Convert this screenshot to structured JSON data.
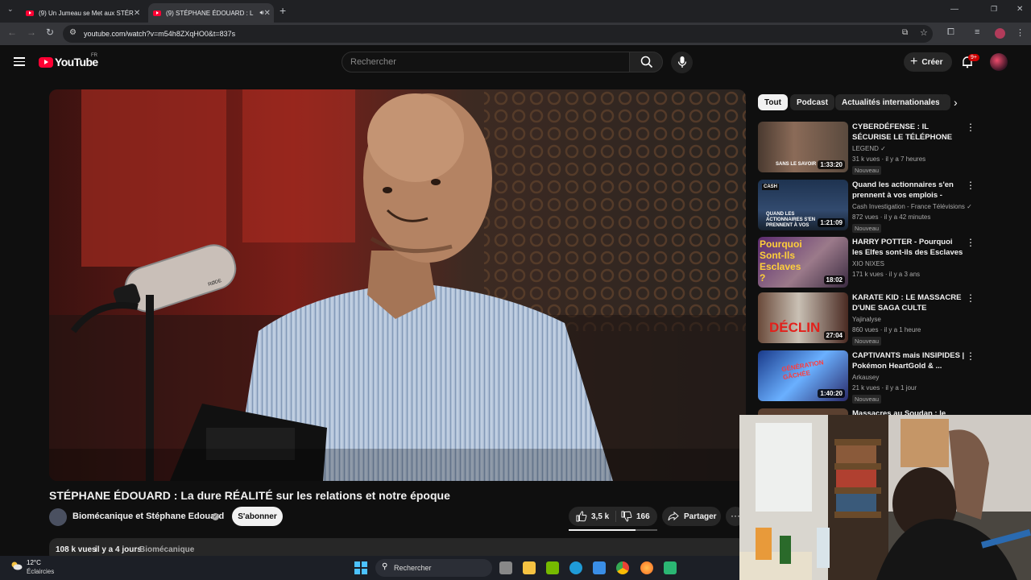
{
  "browser": {
    "tabs": [
      {
        "title": "(9) Un Jumeau se Met aux STÉR"
      },
      {
        "title": "(9) STÉPHANE ÉDOUARD : L"
      }
    ],
    "url": "youtube.com/watch?v=m54h8ZXqHO0&t=837s"
  },
  "header": {
    "logo": "YouTube",
    "region": "FR",
    "search_placeholder": "Rechercher",
    "create_label": "Créer",
    "notification_count": "9+"
  },
  "video": {
    "title": "STÉPHANE ÉDOUARD : La dure RÉALITÉ sur les relations et notre époque",
    "channel": "Biomécanique et Stéphane Edouard",
    "subscribe_label": "S'abonner",
    "likes": "3,5 k",
    "dislikes": "166",
    "share_label": "Partager",
    "more_label": "···",
    "views": "108 k vues",
    "date": "il y a 4 jours",
    "tag": "Biomécanique",
    "mic_brand": "RØDE"
  },
  "chips": [
    "Tout",
    "Podcast",
    "Actualités internationales"
  ],
  "recommendations": [
    {
      "title": "CYBERDÉFENSE : IL SÉCURISE LE TÉLÉPHONE DU PRÉSIDEN...",
      "channel": "LEGEND",
      "verified": true,
      "meta": "31 k vues · il y a 7 heures",
      "badge": "Nouveau",
      "duration": "1:33:20",
      "thumb_text": "SANS LE SAVOIR"
    },
    {
      "title": "Quand les actionnaires s'en prennent à vos emplois - Cash...",
      "channel": "Cash Investigation - France Télévisions",
      "verified": true,
      "meta": "872 vues · il y a 42 minutes",
      "badge": "Nouveau",
      "duration": "1:21:09",
      "thumb_text": "QUAND LES ACTIONNAIRES S'EN PRENNENT À VOS",
      "thumb_label": "CASH"
    },
    {
      "title": "HARRY POTTER - Pourquoi les Elfes sont-ils des Esclaves ?",
      "channel": "XIO NIXES",
      "verified": false,
      "meta": "171 k vues · il y a 3 ans",
      "badge": "",
      "duration": "18:02",
      "thumb_text": "Pourquoi Sont-Ils Esclaves ?"
    },
    {
      "title": "KARATE KID : LE MASSACRE D'UNE SAGA CULTE",
      "channel": "Yajinalyse",
      "verified": false,
      "meta": "860 vues · il y a 1 heure",
      "badge": "Nouveau",
      "duration": "27:04",
      "thumb_text": "DÉCLIN"
    },
    {
      "title": "CAPTIVANTS mais INSIPIDES | Pokémon HeartGold & ...",
      "channel": "Arkausey",
      "verified": false,
      "meta": "21 k vues · il y a 1 jour",
      "badge": "Nouveau",
      "duration": "1:40:20",
      "thumb_text": "GÉNÉRATION GÂCHÉE"
    },
    {
      "title": "Massacres au Soudan : le",
      "channel": "",
      "verified": false,
      "meta": "",
      "badge": "",
      "duration": "",
      "thumb_text": ""
    }
  ],
  "taskbar": {
    "temperature": "12°C",
    "weather": "Éclaircies",
    "search_label": "Rechercher"
  },
  "colors": {
    "background": "#0f0f0f",
    "accent": "#ff0033",
    "surface": "#272727",
    "text": "#f1f1f1",
    "muted": "#aaaaaa"
  }
}
